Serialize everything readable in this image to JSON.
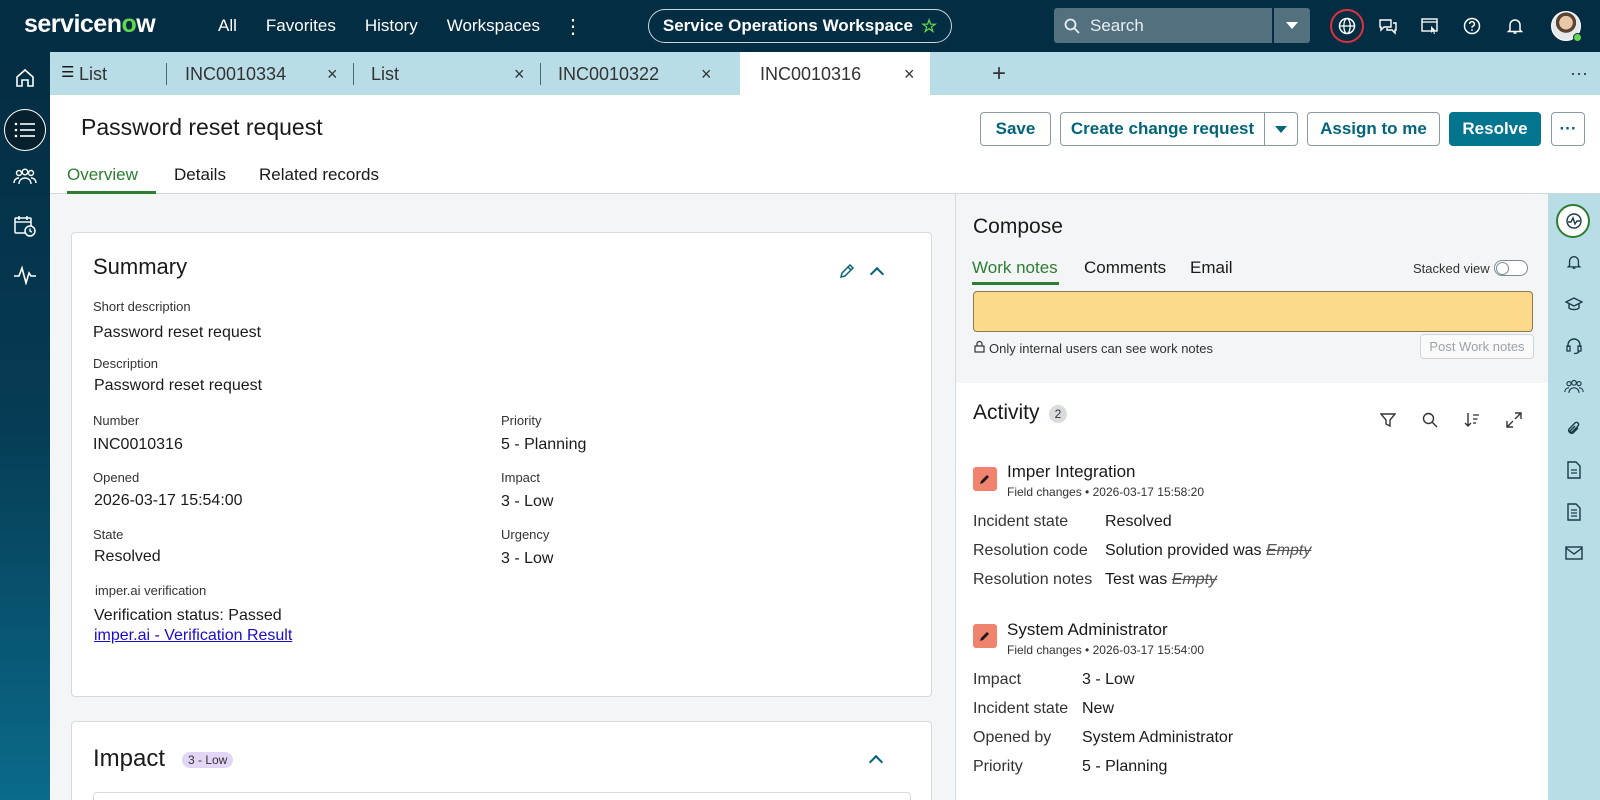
{
  "app": {
    "logo_text": "servicenow",
    "nav": [
      "All",
      "Favorites",
      "History",
      "Workspaces"
    ],
    "workspace": "Service Operations Workspace",
    "search_placeholder": "Search"
  },
  "tabs": [
    {
      "label": "List",
      "closable": false,
      "menu": true
    },
    {
      "label": "INC0010334",
      "closable": true
    },
    {
      "label": "List",
      "closable": true
    },
    {
      "label": "INC0010322",
      "closable": true
    },
    {
      "label": "INC0010316",
      "closable": true,
      "active": true
    }
  ],
  "record": {
    "title": "Password reset request",
    "buttons": {
      "save": "Save",
      "create_change": "Create change request",
      "assign": "Assign to me",
      "resolve": "Resolve",
      "more": "···"
    },
    "subtabs": [
      "Overview",
      "Details",
      "Related records"
    ]
  },
  "summary": {
    "title": "Summary",
    "short_description_label": "Short description",
    "short_description": "Password reset request",
    "description_label": "Description",
    "description": "Password reset request",
    "number_label": "Number",
    "number": "INC0010316",
    "priority_label": "Priority",
    "priority": "5 - Planning",
    "opened_label": "Opened",
    "opened": "2026-03-17 15:54:00",
    "impact_label": "Impact",
    "impact": "3 - Low",
    "state_label": "State",
    "state": "Resolved",
    "urgency_label": "Urgency",
    "urgency": "3 - Low",
    "verification_label": "imper.ai verification",
    "verification_status": "Verification status: Passed",
    "verification_link": "imper.ai - Verification Result"
  },
  "impact_card": {
    "title": "Impact",
    "badge": "3 - Low"
  },
  "compose": {
    "title": "Compose",
    "tabs": [
      "Work notes",
      "Comments",
      "Email"
    ],
    "stacked_view": "Stacked view",
    "internal_note": "Only internal users can see work notes",
    "post_button": "Post Work notes"
  },
  "activity": {
    "title": "Activity",
    "count": "2",
    "entries": [
      {
        "author": "Imper Integration",
        "type": "Field changes",
        "time": "2026-03-17 15:58:20",
        "fields": [
          {
            "key": "Incident state",
            "value": "Resolved",
            "old": ""
          },
          {
            "key": "Resolution code",
            "value": "Solution provided was",
            "old": "Empty"
          },
          {
            "key": "Resolution notes",
            "value": "Test was",
            "old": "Empty"
          }
        ]
      },
      {
        "author": "System Administrator",
        "type": "Field changes",
        "time": "2026-03-17 15:54:00",
        "fields": [
          {
            "key": "Impact",
            "value": "3 - Low"
          },
          {
            "key": "Incident state",
            "value": "New"
          },
          {
            "key": "Opened by",
            "value": "System Administrator"
          },
          {
            "key": "Priority",
            "value": "5 - Planning"
          }
        ]
      }
    ]
  },
  "colors": {
    "nav_bg": "#032d42",
    "accent_green": "#2e7d32",
    "primary": "#03758f",
    "tabstrip": "#b9dde6",
    "worknote": "#fdd98b"
  }
}
